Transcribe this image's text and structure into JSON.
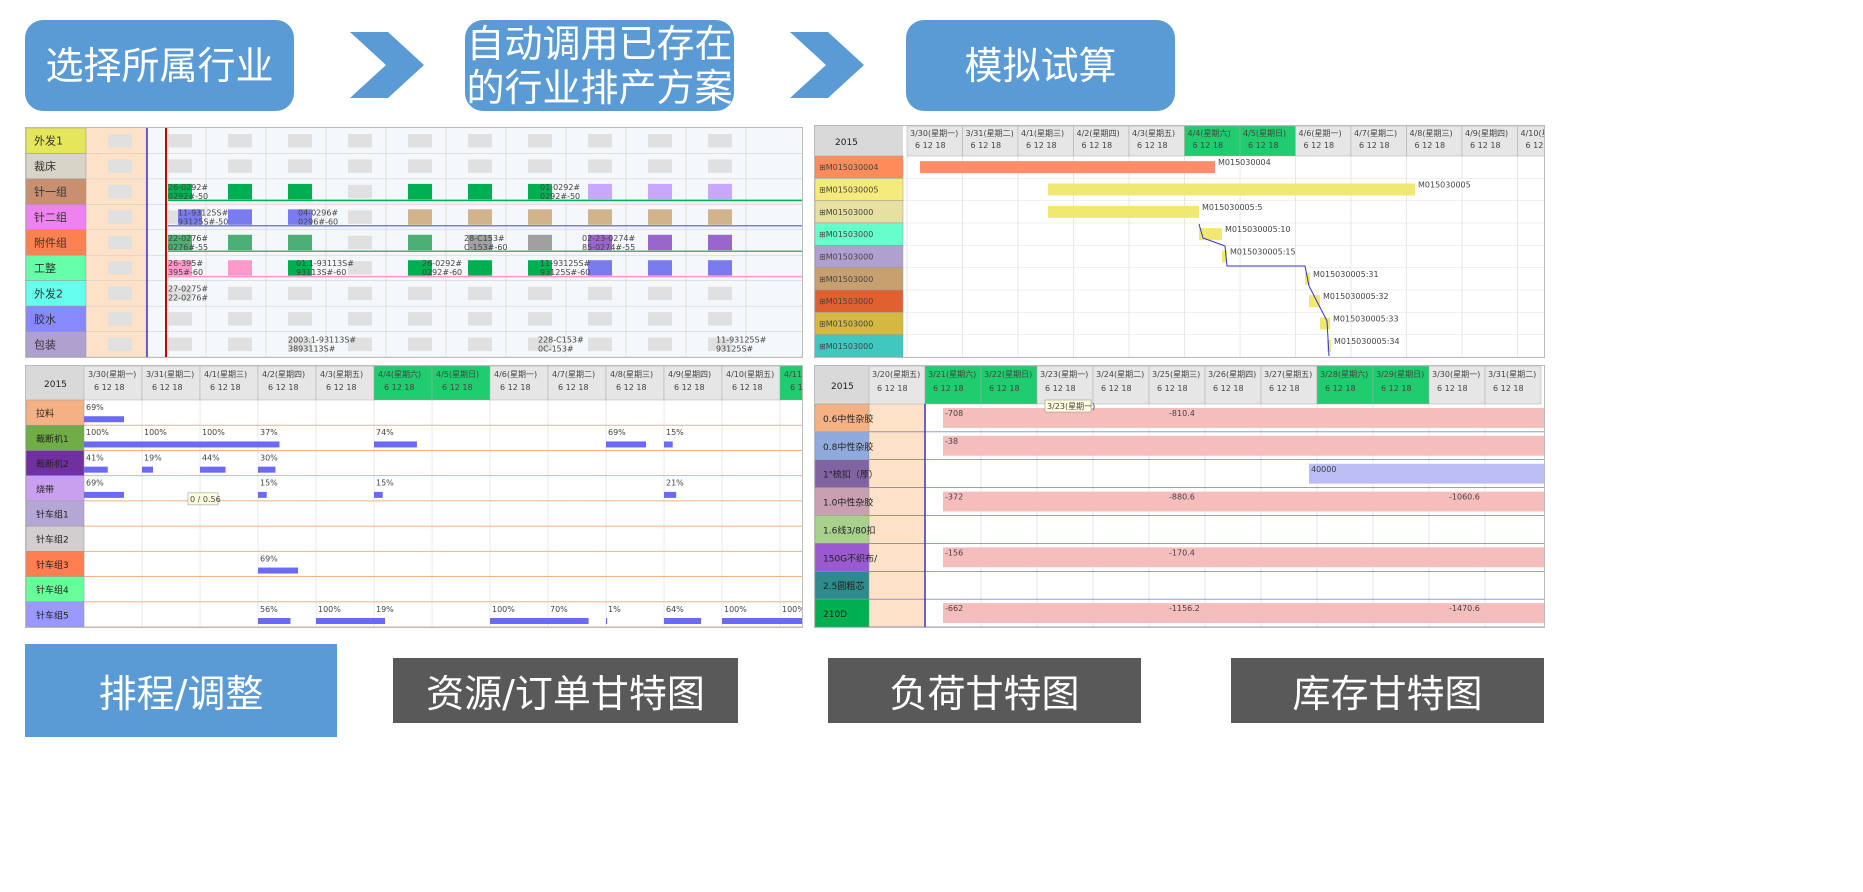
{
  "steps": [
    {
      "label": "选择所属行业"
    },
    {
      "label": "自动调用已存在",
      "label2": "的行业排产方案"
    },
    {
      "label": "模拟试算"
    }
  ],
  "captions": {
    "schedule": "排程/调整",
    "resource": "资源/订单甘特图",
    "load": "负荷甘特图",
    "inventory": "库存甘特图"
  },
  "colors": {
    "accent": "#5b9bd5",
    "dark": "#595959",
    "green": "#00b050"
  },
  "panel1": {
    "rows": [
      {
        "name": "外发1",
        "color": "#e6e65a"
      },
      {
        "name": "裁床",
        "color": "#d9d4c8"
      },
      {
        "name": "针一组",
        "color": "#c89070"
      },
      {
        "name": "针二组",
        "color": "#ee82ee"
      },
      {
        "name": "附件组",
        "color": "#ff8050"
      },
      {
        "name": "工整",
        "color": "#66ffaa"
      },
      {
        "name": "外发2",
        "color": "#66ffee"
      },
      {
        "name": "胶水",
        "color": "#8888ff"
      },
      {
        "name": "包装",
        "color": "#b0a0d0"
      }
    ],
    "notes": [
      "26-0292#",
      "0292#-50",
      "11-93125S#",
      "93125S#-50",
      "04-0296#",
      "0296#-60",
      "22-0276#",
      "0276#-55",
      "28-C153#",
      "C-153#-60",
      "02-23-0274#",
      "85-0274#-55",
      "26-395#",
      "395#-60",
      "01.1-93113S#",
      "93113S#-60",
      "26-0292#",
      "0292#-60",
      "11-93125S#",
      "93125S#-60",
      "27-0275#",
      "22-0276#",
      "01-0292#",
      "0292#-50",
      "2003.1-93113S#",
      "3893113S#",
      "228-C153#",
      "0C-153#",
      "11-93125S#",
      "93125S#"
    ]
  },
  "panel2": {
    "year": "2015",
    "dates": [
      "3/30(星期一)",
      "3/31(星期二)",
      "4/1(星期三)",
      "4/2(星期四)",
      "4/3(星期五)",
      "4/4(星期六)",
      "4/5(星期日)",
      "4/6(星期一)",
      "4/7(星期二)",
      "4/8(星期三)",
      "4/9(星期四)",
      "4/10(星期"
    ],
    "rows": [
      {
        "name": "M015030004",
        "color": "#ff8c5a",
        "note": "M015030004"
      },
      {
        "name": "M015030005",
        "color": "#f5eb7a",
        "note": "M015030005"
      },
      {
        "name": "M01503000",
        "color": "#e8e0a0",
        "note": "M015030005:5"
      },
      {
        "name": "M01503000",
        "color": "#66ffcc",
        "note": "M015030005:10"
      },
      {
        "name": "M01503000",
        "color": "#b0a0d0",
        "note": "M015030005:15"
      },
      {
        "name": "M01503000",
        "color": "#c8a070",
        "note": "M015030005:31"
      },
      {
        "name": "M01503000",
        "color": "#e06030",
        "note": "M015030005:32"
      },
      {
        "name": "M01503000",
        "color": "#d4b840",
        "note": "M015030005:33"
      },
      {
        "name": "M01503000",
        "color": "#40c8c0",
        "note": "M015030005:34"
      }
    ]
  },
  "panel3": {
    "year": "2015",
    "dates": [
      "3/30(星期一)",
      "3/31(星期二)",
      "4/1(星期三)",
      "4/2(星期四)",
      "4/3(星期五)",
      "4/4(星期六)",
      "4/5(星期日)",
      "4/6(星期一)",
      "4/7(星期二)",
      "4/8(星期三)",
      "4/9(星期四)",
      "4/10(星期五)",
      "4/11"
    ],
    "rows": [
      {
        "name": "拉料",
        "color": "#f4b183"
      },
      {
        "name": "裁断机1",
        "color": "#70ad47"
      },
      {
        "name": "裁断机2",
        "color": "#7030a0"
      },
      {
        "name": "烧带",
        "color": "#c9a0f0"
      },
      {
        "name": "针车组1",
        "color": "#b4a7d6"
      },
      {
        "name": "针车组2",
        "color": "#d0cece"
      },
      {
        "name": "针车组3",
        "color": "#ff7f50"
      },
      {
        "name": "针车组4",
        "color": "#66ff99"
      },
      {
        "name": "针车组5",
        "color": "#9999ff"
      }
    ],
    "loads": [
      [
        "69%"
      ],
      [
        "100%",
        "100%",
        "100%",
        "37%",
        "74%",
        "69%",
        "15%"
      ],
      [
        "41%",
        "19%",
        "44%",
        "30%"
      ],
      [
        "69%",
        "15%",
        "15%",
        "21%"
      ],
      [],
      [],
      [
        "69%"
      ],
      [],
      [
        "56%",
        "100%",
        "19%",
        "100%",
        "70%",
        "1%",
        "64%",
        "100%",
        "100%"
      ]
    ],
    "tooltip": "0 / 0.56"
  },
  "panel4": {
    "year": "2015",
    "dates": [
      "3/20(星期五)",
      "3/21(星期六)",
      "3/22(星期日)",
      "3/23(星期一)",
      "3/24(星期二)",
      "3/25(星期三)",
      "3/26(星期四)",
      "3/27(星期五)",
      "3/28(星期六)",
      "3/29(星期日)",
      "3/30(星期一)",
      "3/31(星期二)"
    ],
    "rows": [
      {
        "name": "0.6中性杂胶",
        "color": "#f4b183",
        "vals": [
          "-708",
          "-810.4"
        ]
      },
      {
        "name": "0.8中性杂胶",
        "color": "#8faadc",
        "vals": [
          "-38"
        ]
      },
      {
        "name": "1\"梳扣（厚）",
        "color": "#8064a2",
        "vals": [
          "40000"
        ]
      },
      {
        "name": "1.0中性杂胶",
        "color": "#c9a0b0",
        "vals": [
          "-372",
          "-880.6",
          "-1060.6"
        ]
      },
      {
        "name": "1.6线3/80扣",
        "color": "#a9d18e",
        "vals": []
      },
      {
        "name": "150G不织布/",
        "color": "#9b59d0",
        "vals": [
          "-156",
          "-170.4"
        ]
      },
      {
        "name": "2.5圆粗芯",
        "color": "#2e8b8b",
        "vals": []
      },
      {
        "name": "210D",
        "color": "#00b050",
        "vals": [
          "-662",
          "-1156.2",
          "-1470.6"
        ]
      }
    ],
    "tooltip": "3/23(星期一)"
  }
}
